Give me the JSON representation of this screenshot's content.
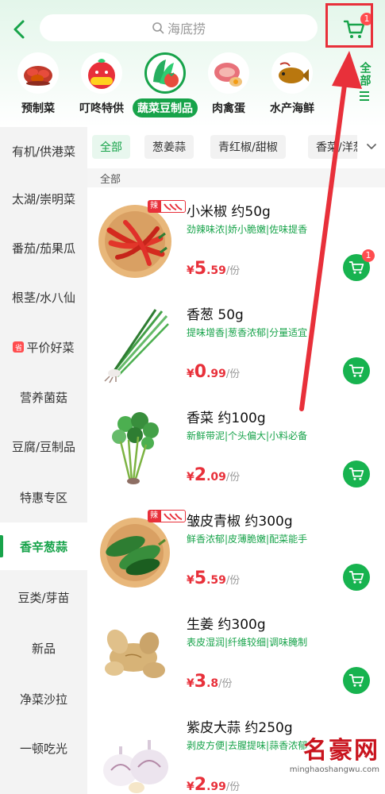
{
  "header": {
    "search_placeholder": "海底捞",
    "cart_count": "1"
  },
  "categories": [
    {
      "label": "预制菜",
      "icon": "crayfish-icon",
      "selected": false
    },
    {
      "label": "叮咚特供",
      "icon": "special-offer-icon",
      "selected": false
    },
    {
      "label": "蔬菜豆制品",
      "icon": "vegetable-icon",
      "selected": true
    },
    {
      "label": "肉禽蛋",
      "icon": "meat-icon",
      "selected": false
    },
    {
      "label": "水产海鲜",
      "icon": "fish-icon",
      "selected": false
    }
  ],
  "all_categories_label": "全部",
  "sidebar": {
    "items": [
      {
        "label": "有机/供港菜"
      },
      {
        "label": "太湖/崇明菜"
      },
      {
        "label": "番茄/茄果瓜"
      },
      {
        "label": "根茎/水八仙"
      },
      {
        "label": "平价好菜",
        "tag": "省"
      },
      {
        "label": "营养菌菇"
      },
      {
        "label": "豆腐/豆制品"
      },
      {
        "label": "特惠专区"
      },
      {
        "label": "香辛葱蒜",
        "active": true
      },
      {
        "label": "豆类/芽苗"
      },
      {
        "label": "新品"
      },
      {
        "label": "净菜沙拉"
      },
      {
        "label": "一顿吃光"
      }
    ]
  },
  "filters": {
    "chips": [
      "全部",
      "葱姜蒜",
      "青红椒/甜椒",
      "香菜/洋葱"
    ],
    "active_index": 0
  },
  "section_title": "全部",
  "products": [
    {
      "name": "小米椒 约50g",
      "tags": "劲辣味浓|娇小脆嫩|佐味提香",
      "price_int": "5",
      "price_dec": ".59",
      "unit": "/份",
      "spicy": "辣",
      "cart_badge": "1"
    },
    {
      "name": "香葱 50g",
      "tags": "提味增香|葱香浓郁|分量适宜",
      "price_int": "0",
      "price_dec": ".99",
      "unit": "/份"
    },
    {
      "name": "香菜 约100g",
      "tags": "新鲜带泥|个头偏大|小料必备",
      "price_int": "2",
      "price_dec": ".09",
      "unit": "/份"
    },
    {
      "name": "皱皮青椒 约300g",
      "tags": "鲜香浓郁|皮薄脆嫩|配菜能手",
      "price_int": "5",
      "price_dec": ".59",
      "unit": "/份",
      "spicy": "辣"
    },
    {
      "name": "生姜 约300g",
      "tags": "表皮湿润|纤维较细|调味腌制",
      "price_int": "3",
      "price_dec": ".8",
      "unit": "/份"
    },
    {
      "name": "紫皮大蒜 约250g",
      "tags": "剥皮方便|去腥提味|蒜香浓郁",
      "price_int": "2",
      "price_dec": ".99",
      "unit": "/份"
    }
  ],
  "currency_symbol": "¥",
  "watermark": {
    "name": "名豪网",
    "url": "minghaoshangwu.com"
  },
  "colors": {
    "brand_green": "#17a34a",
    "price_red": "#e8303a",
    "annotation_red": "#e8303a"
  }
}
